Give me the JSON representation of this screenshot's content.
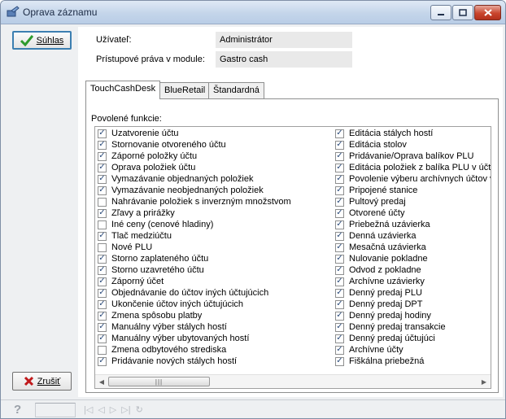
{
  "window": {
    "title": "Oprava záznamu"
  },
  "buttons": {
    "ok_label": "Súhlas",
    "cancel_label": "Zrušiť"
  },
  "fields": [
    {
      "label": "Užívateľ:",
      "value": "Administrátor"
    },
    {
      "label": "Prístupové práva v module:",
      "value": "Gastro cash"
    }
  ],
  "tabs": [
    {
      "label": "TouchCashDesk",
      "active": true
    },
    {
      "label": "BlueRetail",
      "active": false
    },
    {
      "label": "Štandardná",
      "active": false
    }
  ],
  "permissions": {
    "label": "Povolené funkcie:",
    "column1": [
      {
        "label": "Uzatvorenie účtu",
        "checked": true
      },
      {
        "label": "Stornovanie otvoreného účtu",
        "checked": true
      },
      {
        "label": "Záporné položky účtu",
        "checked": true
      },
      {
        "label": "Oprava položiek účtu",
        "checked": true
      },
      {
        "label": "Vymazávanie objednaných položiek",
        "checked": true
      },
      {
        "label": "Vymazávanie neobjednaných položiek",
        "checked": true
      },
      {
        "label": "Nahrávanie položiek s inverzným množstvom",
        "checked": false
      },
      {
        "label": "Zľavy a prirážky",
        "checked": true
      },
      {
        "label": "Iné ceny (cenové hladiny)",
        "checked": false
      },
      {
        "label": "Tlač medziúčtu",
        "checked": true
      },
      {
        "label": "Nové PLU",
        "checked": false
      },
      {
        "label": "Storno zaplateného účtu",
        "checked": true
      },
      {
        "label": "Storno uzavretého účtu",
        "checked": true
      },
      {
        "label": "Záporný účet",
        "checked": true
      },
      {
        "label": "Objednávanie do účtov iných účtujúcich",
        "checked": true
      },
      {
        "label": "Ukončenie účtov iných účtujúcich",
        "checked": true
      },
      {
        "label": "Zmena spôsobu platby",
        "checked": true
      },
      {
        "label": "Manuálny výber stálych hostí",
        "checked": true
      },
      {
        "label": "Manuálny výber ubytovaných hostí",
        "checked": true
      },
      {
        "label": "Zmena odbytového strediska",
        "checked": false
      },
      {
        "label": "Pridávanie nových stálych hostí",
        "checked": true
      }
    ],
    "column2": [
      {
        "label": "Editácia stálych hostí",
        "checked": true
      },
      {
        "label": "Editácia stolov",
        "checked": true
      },
      {
        "label": "Pridávanie/Oprava balíkov PLU",
        "checked": true
      },
      {
        "label": "Editácia položiek z balíka PLU v účte",
        "checked": true
      },
      {
        "label": "Povolenie výberu archívnych účtov v",
        "checked": true
      },
      {
        "label": "Pripojené stanice",
        "checked": true
      },
      {
        "label": "Pultový predaj",
        "checked": true
      },
      {
        "label": "Otvorené účty",
        "checked": true
      },
      {
        "label": "Priebežná uzávierka",
        "checked": true
      },
      {
        "label": "Denná uzávierka",
        "checked": true
      },
      {
        "label": "Mesačná uzávierka",
        "checked": true
      },
      {
        "label": "Nulovanie pokladne",
        "checked": true
      },
      {
        "label": "Odvod z pokladne",
        "checked": true
      },
      {
        "label": "Archívne uzávierky",
        "checked": true
      },
      {
        "label": "Denný predaj PLU",
        "checked": true
      },
      {
        "label": "Denný predaj DPT",
        "checked": true
      },
      {
        "label": "Denný predaj hodiny",
        "checked": true
      },
      {
        "label": "Denný predaj transakcie",
        "checked": true
      },
      {
        "label": "Denný predaj účtujúci",
        "checked": true
      },
      {
        "label": "Archívne účty",
        "checked": true
      },
      {
        "label": "Fiškálna priebežná",
        "checked": true
      }
    ]
  },
  "icons": {
    "app": "app-icon",
    "ok": "checkmark-icon",
    "cancel": "x-icon",
    "help": "help-icon"
  },
  "colors": {
    "accent": "#3c7fb1",
    "check": "#2a4a7a",
    "cancel_x": "#c0191b",
    "ok_check": "#2e9b2e"
  }
}
